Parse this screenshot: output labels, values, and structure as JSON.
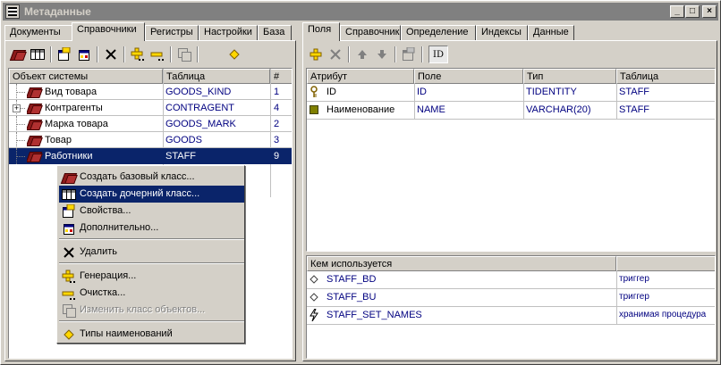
{
  "window": {
    "title": "Метаданные"
  },
  "left_tabs": [
    "Документы",
    "Справочники",
    "Регистры",
    "Настройки",
    "База"
  ],
  "left_active_tab": "Справочники",
  "tree": {
    "columns": [
      "Объект системы",
      "Таблица",
      "#"
    ],
    "rows": [
      {
        "name": "Вид товара",
        "table": "GOODS_KIND",
        "num": "1",
        "expandable": false,
        "selected": false
      },
      {
        "name": "Контрагенты",
        "table": "CONTRAGENT",
        "num": "4",
        "expandable": true,
        "selected": false
      },
      {
        "name": "Марка товара",
        "table": "GOODS_MARK",
        "num": "2",
        "expandable": false,
        "selected": false
      },
      {
        "name": "Товар",
        "table": "GOODS",
        "num": "3",
        "expandable": false,
        "selected": false
      },
      {
        "name": "Работники",
        "table": "STAFF",
        "num": "9",
        "expandable": false,
        "selected": true
      }
    ]
  },
  "context_menu": {
    "items": [
      {
        "label": "Создать базовый класс...",
        "icon": "book-icon",
        "disabled": false,
        "highlighted": false
      },
      {
        "label": "Создать дочерний класс...",
        "icon": "table-icon",
        "disabled": false,
        "highlighted": true
      },
      {
        "label": "Свойства...",
        "icon": "properties-icon",
        "disabled": false,
        "highlighted": false
      },
      {
        "label": "Дополнительно...",
        "icon": "extra-properties-icon",
        "disabled": false,
        "highlighted": false
      },
      {
        "label": "Удалить",
        "icon": "delete-icon",
        "disabled": false,
        "highlighted": false
      },
      {
        "label": "Генерация...",
        "icon": "generate-icon",
        "disabled": false,
        "highlighted": false
      },
      {
        "label": "Очистка...",
        "icon": "clear-icon",
        "disabled": false,
        "highlighted": false
      },
      {
        "label": "Изменить класс объектов...",
        "icon": "change-class-icon",
        "disabled": true,
        "highlighted": false
      },
      {
        "label": "Типы наименований",
        "icon": "diamond-icon",
        "disabled": false,
        "highlighted": false
      }
    ]
  },
  "right_tabs": [
    "Поля",
    "Справочник",
    "Определение",
    "Индексы",
    "Данные"
  ],
  "right_active_tab": "Поля",
  "fields": {
    "columns": [
      "Атрибут",
      "Поле",
      "Тип",
      "Таблица"
    ],
    "rows": [
      {
        "attr": "ID",
        "field": "ID",
        "type": "TIDENTITY",
        "table": "STAFF",
        "icon": "key-icon"
      },
      {
        "attr": "Наименование",
        "field": "NAME",
        "type": "VARCHAR(20)",
        "table": "STAFF",
        "icon": "field-icon"
      }
    ]
  },
  "usage": {
    "header": "Кем используется",
    "rows": [
      {
        "name": "STAFF_BD",
        "kind": "триггер",
        "icon": "diamond-outline-icon"
      },
      {
        "name": "STAFF_BU",
        "kind": "триггер",
        "icon": "diamond-outline-icon"
      },
      {
        "name": "STAFF_SET_NAMES",
        "kind": "хранимая процедура",
        "icon": "lightning-icon"
      }
    ]
  },
  "toolbar_right": {
    "id_button_label": "ID"
  }
}
